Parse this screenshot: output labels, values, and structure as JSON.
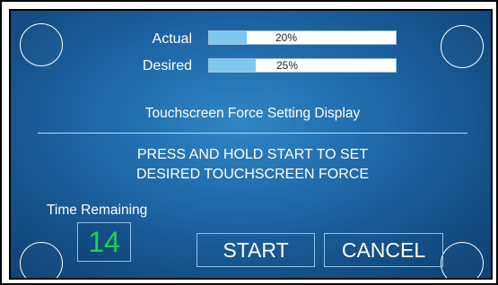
{
  "meters": [
    {
      "label": "Actual",
      "value_text": "20%",
      "fill_fraction": 0.2
    },
    {
      "label": "Desired",
      "value_text": "25%",
      "fill_fraction": 0.25
    }
  ],
  "subtitle": "Touchscreen Force Setting Display",
  "instructions": {
    "line1": "PRESS AND HOLD START TO SET",
    "line2": "DESIRED TOUCHSCREEN FORCE"
  },
  "timer": {
    "label": "Time Remaining",
    "value": "14",
    "value_color": "#1fd14f"
  },
  "buttons": {
    "start": "START",
    "cancel": "CANCEL"
  },
  "colors": {
    "background": "#1f66a6",
    "meter_fill": "#7ec7ef",
    "meter_track": "#ffffff",
    "text": "#ffffff"
  }
}
